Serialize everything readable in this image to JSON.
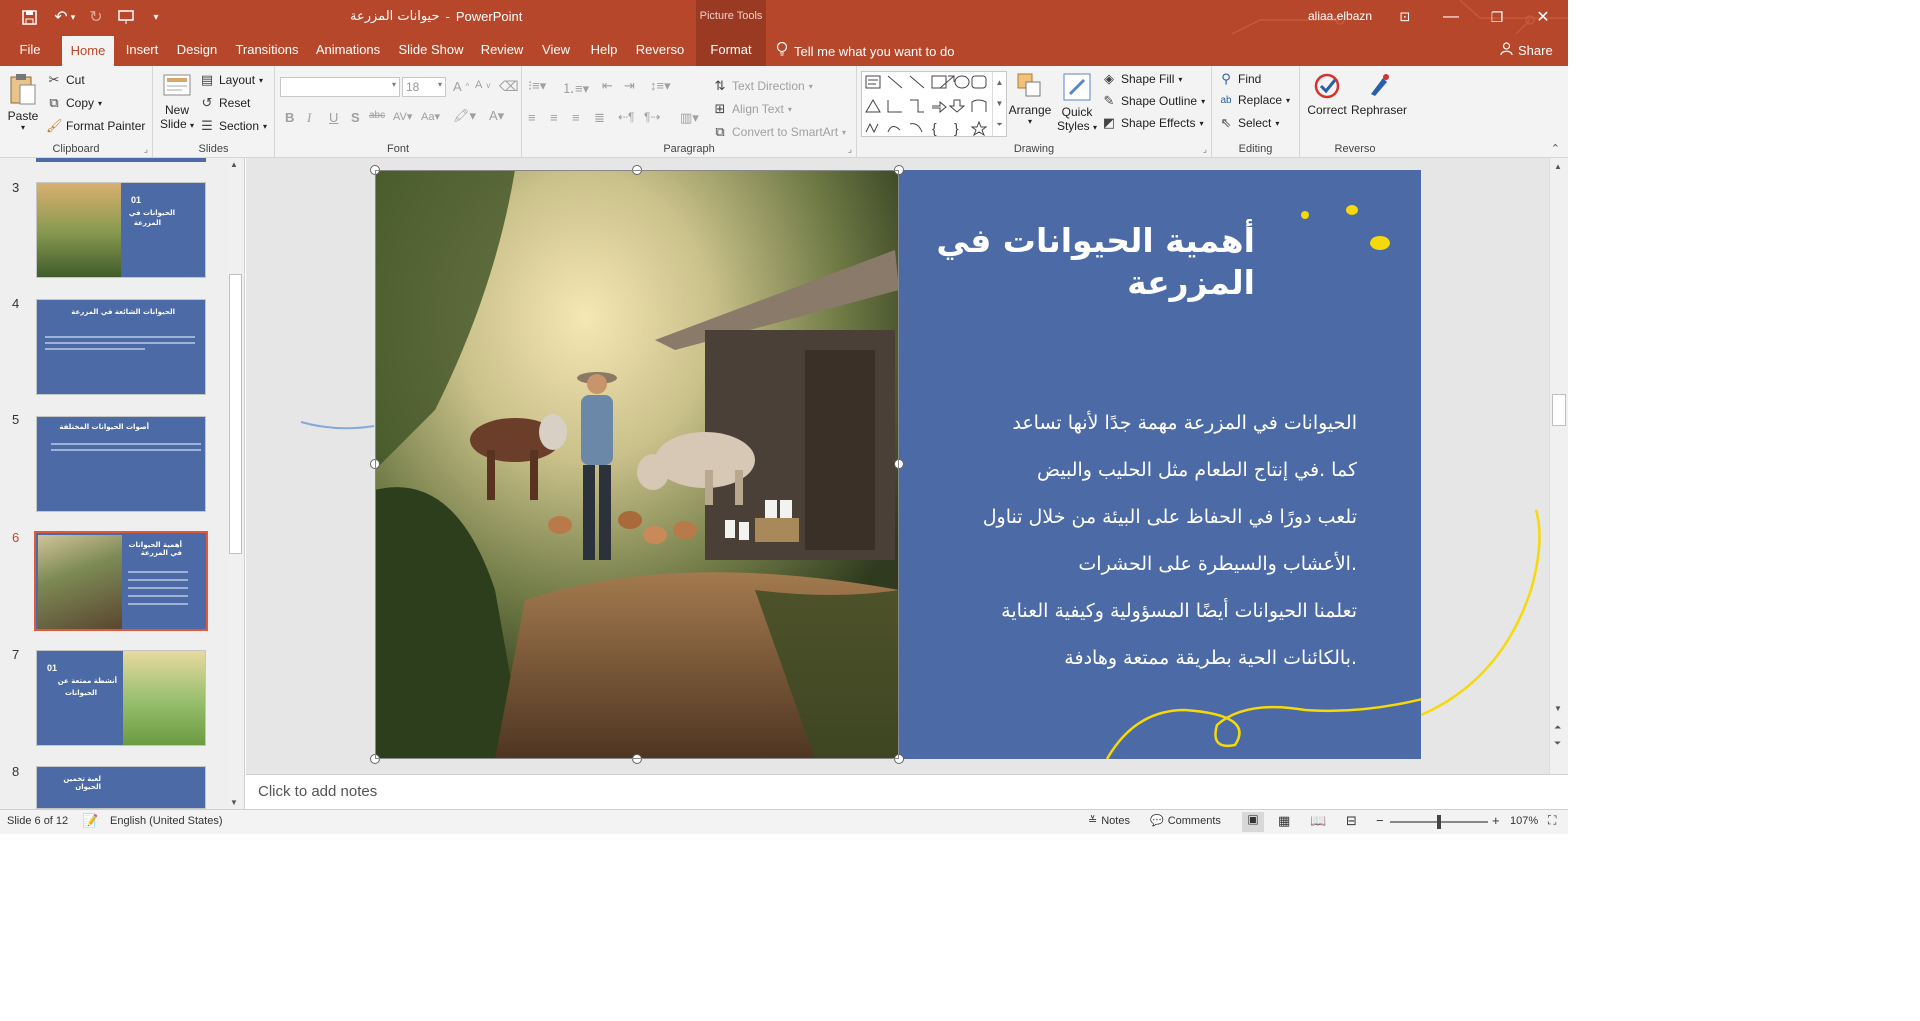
{
  "titlebar": {
    "doc_title": "حيوانات المزرعة",
    "separator": "-",
    "app_name": "PowerPoint",
    "context_tool": "Picture Tools",
    "user": "aliaa.elbazn"
  },
  "tabs": [
    "File",
    "Home",
    "Insert",
    "Design",
    "Transitions",
    "Animations",
    "Slide Show",
    "Review",
    "View",
    "Help",
    "Reverso",
    "Format"
  ],
  "tell_me": "Tell me what you want to do",
  "share": "Share",
  "ribbon": {
    "clipboard": {
      "paste": "Paste",
      "cut": "Cut",
      "copy": "Copy",
      "format_painter": "Format Painter",
      "label": "Clipboard"
    },
    "slides": {
      "new_slide_1": "New",
      "new_slide_2": "Slide",
      "layout": "Layout",
      "reset": "Reset",
      "section": "Section",
      "label": "Slides"
    },
    "font": {
      "font_name": "",
      "font_size": "18",
      "label": "Font"
    },
    "paragraph": {
      "text_direction": "Text Direction",
      "align_text": "Align Text",
      "convert_smartart": "Convert to SmartArt",
      "label": "Paragraph"
    },
    "drawing": {
      "arrange": "Arrange",
      "quick_styles_1": "Quick",
      "quick_styles_2": "Styles",
      "shape_fill": "Shape Fill",
      "shape_outline": "Shape Outline",
      "shape_effects": "Shape Effects",
      "label": "Drawing"
    },
    "editing": {
      "find": "Find",
      "replace": "Replace",
      "select": "Select",
      "label": "Editing"
    },
    "reverso": {
      "correct": "Correct",
      "rephraser": "Rephraser",
      "label": "Reverso"
    }
  },
  "thumbnails": [
    {
      "num": "3",
      "line1": "01",
      "line2": "الحيوانات في",
      "line3": "المزرعة"
    },
    {
      "num": "4",
      "title": "الحيوانات الشائعة في المزرعة"
    },
    {
      "num": "5",
      "title": "أصوات الحيوانات المختلفة"
    },
    {
      "num": "6",
      "title": "أهمية الحيوانات في المزرعة"
    },
    {
      "num": "7",
      "line1": "01",
      "line2": "أنشطة ممتعة عن",
      "line3": "الحيوانات"
    },
    {
      "num": "8",
      "title": "لعبة تخمين الحيوان"
    }
  ],
  "slide": {
    "title_line1": "أهمية الحيوانات في",
    "title_line2": "المزرعة",
    "body": [
      "الحيوانات في المزرعة مهمة جدًا لأنها تساعد",
      "كما .في إنتاج الطعام مثل الحليب والبيض",
      "تلعب دورًا في الحفاظ على البيئة من خلال تناول",
      ".الأعشاب والسيطرة على الحشرات",
      "تعلمنا الحيوانات أيضًا المسؤولية وكيفية العناية",
      ".بالكائنات الحية بطريقة ممتعة وهادفة"
    ],
    "bg_color": "#4b6aa6",
    "accent_color": "#f5d90a"
  },
  "notes_placeholder": "Click to add notes",
  "status": {
    "slide_count": "Slide 6 of 12",
    "language": "English (United States)",
    "notes": "Notes",
    "comments": "Comments",
    "zoom": "107%"
  }
}
